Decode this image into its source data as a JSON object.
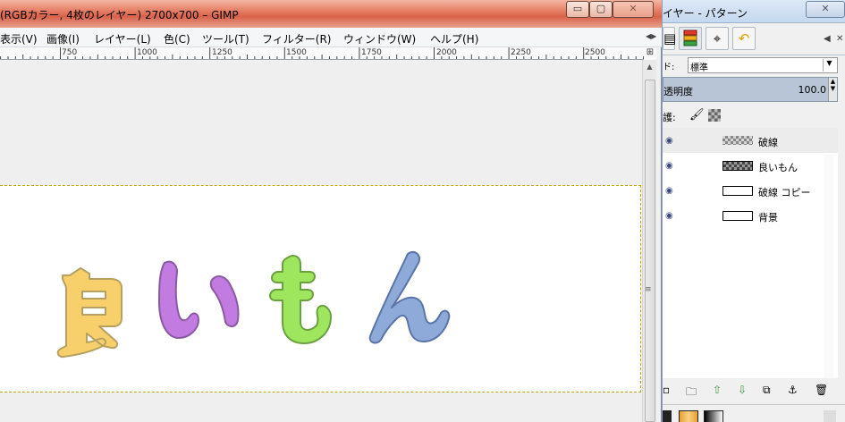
{
  "main_window": {
    "title": "(RGBカラー, 4枚のレイヤー) 2700x700 – GIMP",
    "controls": {
      "minimize": "▭",
      "maximize": "▢",
      "close": "✕"
    }
  },
  "menu": {
    "items": [
      "表示(V)",
      "画像(I)",
      "レイヤー(L)",
      "色(C)",
      "ツール(T)",
      "フィルター(R)",
      "ウィンドウ(W)",
      "ヘルプ(H)"
    ]
  },
  "ruler": {
    "labels": [
      "750",
      "1000",
      "1250",
      "1500",
      "1750",
      "2000",
      "2250",
      "2500"
    ]
  },
  "canvas": {
    "text": "良いもん",
    "colors": {
      "kanji": "#f7d06b",
      "i": "#c27be0",
      "mo": "#9fe65f",
      "n": "#8eaad8",
      "outline": "#aaaaaa"
    }
  },
  "dock": {
    "title": "イヤー - パターン",
    "close": "✕",
    "tabs": [
      "layers-tab",
      "channels-tab",
      "paths-tab",
      "undo-tab"
    ],
    "mode_label": "ド:",
    "mode_value": "標準",
    "opacity_label": "透明度",
    "opacity_value": "100.0",
    "lock_label": "護:",
    "layers": [
      {
        "name": "破線",
        "thumb": "checker",
        "selected": true
      },
      {
        "name": "良いもん",
        "thumb": "dark",
        "selected": false
      },
      {
        "name": "破線 コピー",
        "thumb": "white",
        "selected": false
      },
      {
        "name": "背景",
        "thumb": "white",
        "selected": false
      }
    ]
  }
}
